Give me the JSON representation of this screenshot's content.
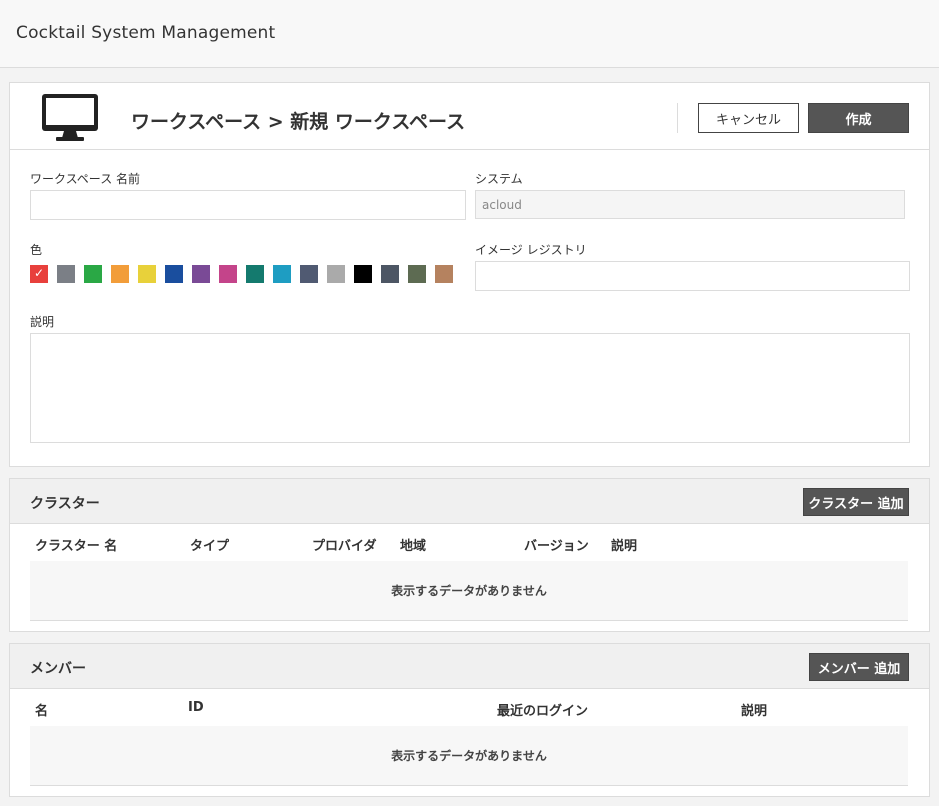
{
  "app": {
    "title": "Cocktail System Management"
  },
  "page": {
    "title": "ワークスペース > 新規 ワークスペース",
    "cancel_label": "キャンセル",
    "create_label": "作成"
  },
  "form": {
    "name_label": "ワークスペース 名前",
    "name_value": "",
    "system_label": "システム",
    "system_value": "acloud",
    "color_label": "色",
    "registry_label": "イメージ レジストリ",
    "registry_value": "",
    "description_label": "説明",
    "description_value": "",
    "colors": [
      "#e8403c",
      "#7b7f86",
      "#2aa845",
      "#f29d3a",
      "#e8d13a",
      "#1a4e9e",
      "#7a4a96",
      "#c4448a",
      "#147a6e",
      "#1e9dc2",
      "#505a72",
      "#aaaaaa",
      "#000000",
      "#4d5664",
      "#5d6b52",
      "#b5825f"
    ],
    "selected_color_index": 0
  },
  "cluster": {
    "title": "クラスター",
    "add_label": "クラスター 追加",
    "columns": [
      "クラスター 名",
      "タイプ",
      "プロバイダ",
      "地域",
      "バージョン",
      "説明"
    ],
    "empty_text": "表示するデータがありません"
  },
  "member": {
    "title": "メンバー",
    "add_label": "メンバー 追加",
    "columns": [
      "名",
      "ID",
      "最近のログイン",
      "説明"
    ],
    "empty_text": "表示するデータがありません"
  }
}
